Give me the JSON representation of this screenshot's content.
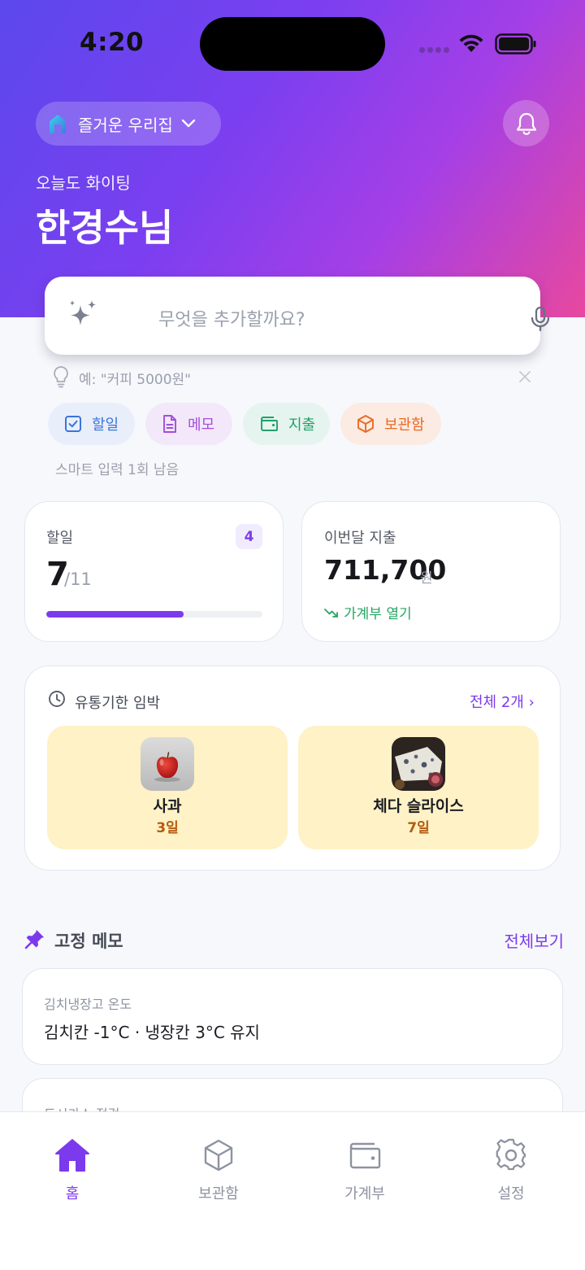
{
  "status_bar": {
    "time": "4:20"
  },
  "header": {
    "home_name": "즐거운 우리집",
    "greeting": "오늘도 화이팅",
    "user_name": "한경수님"
  },
  "quick_input": {
    "placeholder": "무엇을 추가할까요?",
    "hint": "예: \"커피 5000원\"",
    "chips": [
      "할일",
      "메모",
      "지출",
      "보관함"
    ],
    "smart_remaining": "스마트 입력 1회 남음"
  },
  "todo_summary": {
    "title": "할일",
    "badge": "4",
    "done": "7",
    "total": "/11",
    "progress_fraction": 0.636
  },
  "expense_summary": {
    "title": "이번달 지출",
    "amount": "711,700",
    "unit": "원",
    "link": "가계부 열기"
  },
  "expiry": {
    "title": "유통기한 임박",
    "view_all": "전체 2개 ›",
    "items": [
      {
        "name": "사과",
        "days": "3일"
      },
      {
        "name": "체다 슬라이스",
        "days": "7일"
      }
    ]
  },
  "pinned_memos": {
    "title": "고정 메모",
    "view_all": "전체보기",
    "items": [
      {
        "title": "김치냉장고 온도",
        "body": "김치칸 -1°C · 냉장칸 3°C 유지"
      },
      {
        "title": "도시가스 점검",
        "body": ""
      }
    ]
  },
  "tab_bar": {
    "tabs": [
      "홈",
      "보관함",
      "가계부",
      "설정"
    ],
    "active": "홈"
  },
  "colors": {
    "accent": "#7c3aed",
    "header_gradient_start": "#5b48ec",
    "header_gradient_end": "#e8489e",
    "expiry_bg": "#fef2c6",
    "expense_link": "#25a564"
  }
}
